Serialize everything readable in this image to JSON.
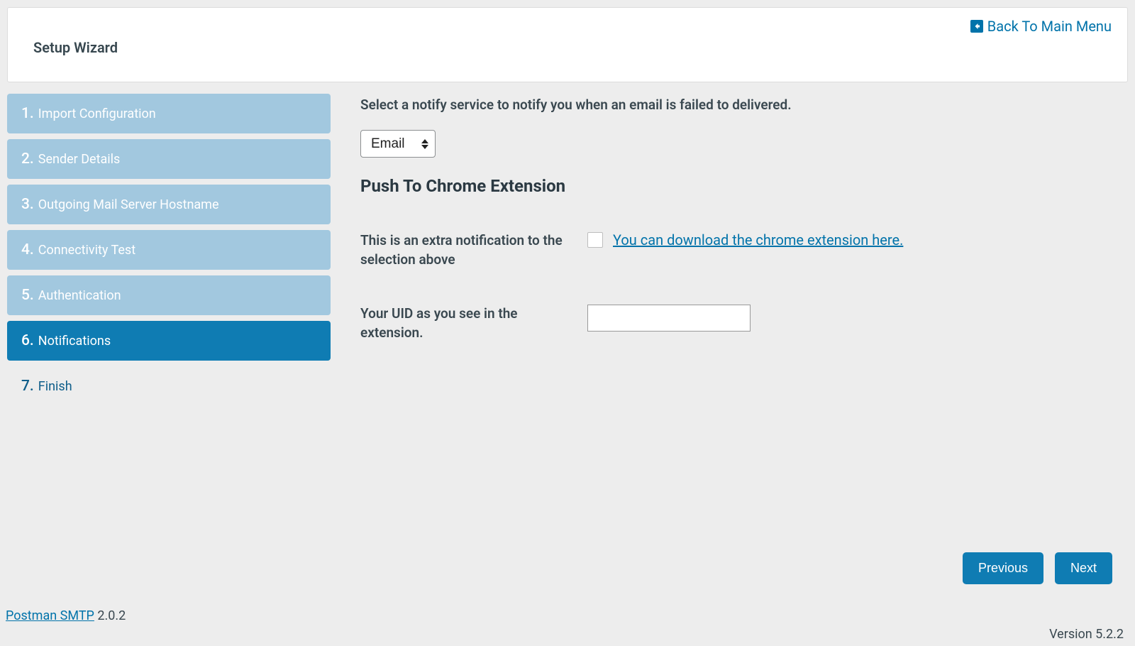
{
  "header": {
    "title": "Setup Wizard",
    "back_label": "Back To Main Menu"
  },
  "steps": [
    {
      "num": "1.",
      "label": "Import Configuration",
      "state": "past"
    },
    {
      "num": "2.",
      "label": "Sender Details",
      "state": "past"
    },
    {
      "num": "3.",
      "label": "Outgoing Mail Server Hostname",
      "state": "past"
    },
    {
      "num": "4.",
      "label": "Connectivity Test",
      "state": "past"
    },
    {
      "num": "5.",
      "label": "Authentication",
      "state": "past"
    },
    {
      "num": "6.",
      "label": "Notifications",
      "state": "current"
    },
    {
      "num": "7.",
      "label": "Finish",
      "state": "future"
    }
  ],
  "content": {
    "prompt": "Select a notify service to notify you when an email is failed to delivered.",
    "notify_select_value": "Email",
    "section_heading": "Push To Chrome Extension",
    "extra_notif_label": "This is an extra notification to the selection above",
    "download_link_text": "You can download the chrome extension here.",
    "uid_label": "Your UID as you see in the extension.",
    "uid_value": "",
    "checkbox_checked": false
  },
  "nav": {
    "previous": "Previous",
    "next": "Next"
  },
  "footer": {
    "product_link": "Postman SMTP",
    "product_version": "2.0.2",
    "platform_version": "Version 5.2.2"
  }
}
